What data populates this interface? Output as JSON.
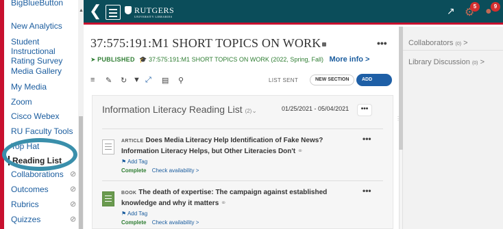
{
  "nav": {
    "items": [
      {
        "label": "BigBlueButton"
      },
      {
        "label": "New Analytics"
      },
      {
        "label": "Student Instructional Rating Survey"
      },
      {
        "label": "Media Gallery"
      },
      {
        "label": "My Media"
      },
      {
        "label": "Zoom"
      },
      {
        "label": "Cisco Webex"
      },
      {
        "label": "RU Faculty Tools"
      },
      {
        "label": "Top Hat"
      },
      {
        "label": "Reading List"
      },
      {
        "label": "Collaborations"
      },
      {
        "label": "Outcomes"
      },
      {
        "label": "Rubrics"
      },
      {
        "label": "Quizzes"
      }
    ]
  },
  "header": {
    "logo_text": "RUTGERS",
    "logo_sub": "UNIVERSITY LIBRARIES",
    "notifications_count": "5",
    "alerts_count": "9"
  },
  "course": {
    "title": "37:575:191:M1 SHORT TOPICS ON WORK",
    "status": "PUBLISHED",
    "code": "37:575:191:M1 SHORT TOPICS ON WORK (2022, Spring, Fall)",
    "more_info": "More info",
    "more_info_chev": ">",
    "menu": "•••"
  },
  "toolbar": {
    "list_sent": "LIST SENT",
    "new_section": "NEW SECTION",
    "add_items": "ADD ITEMS"
  },
  "reading_list": {
    "title": "Information Literacy Reading List",
    "count": "(2)",
    "dates": "01/25/2021 - 05/04/2021",
    "menu": "•••",
    "items": [
      {
        "kind": "ARTICLE",
        "title": "Does Media Literacy Help Identification of Fake News? Information Literacy Helps, but Other Literacies Don't",
        "tag": "Add Tag",
        "status": "Complete",
        "availability": "Check availability >",
        "menu": "•••"
      },
      {
        "kind": "BOOK",
        "title": "The death of expertise: The campaign against established knowledge and why it matters",
        "tag": "Add Tag",
        "status": "Complete",
        "availability": "Check availability >",
        "menu": "•••"
      }
    ]
  },
  "right_panel": {
    "collaborators": "Collaborators",
    "collaborators_count": "(0)",
    "library_discussion": "Library Discussion",
    "library_discussion_count": "(0)",
    "chev": ">"
  }
}
